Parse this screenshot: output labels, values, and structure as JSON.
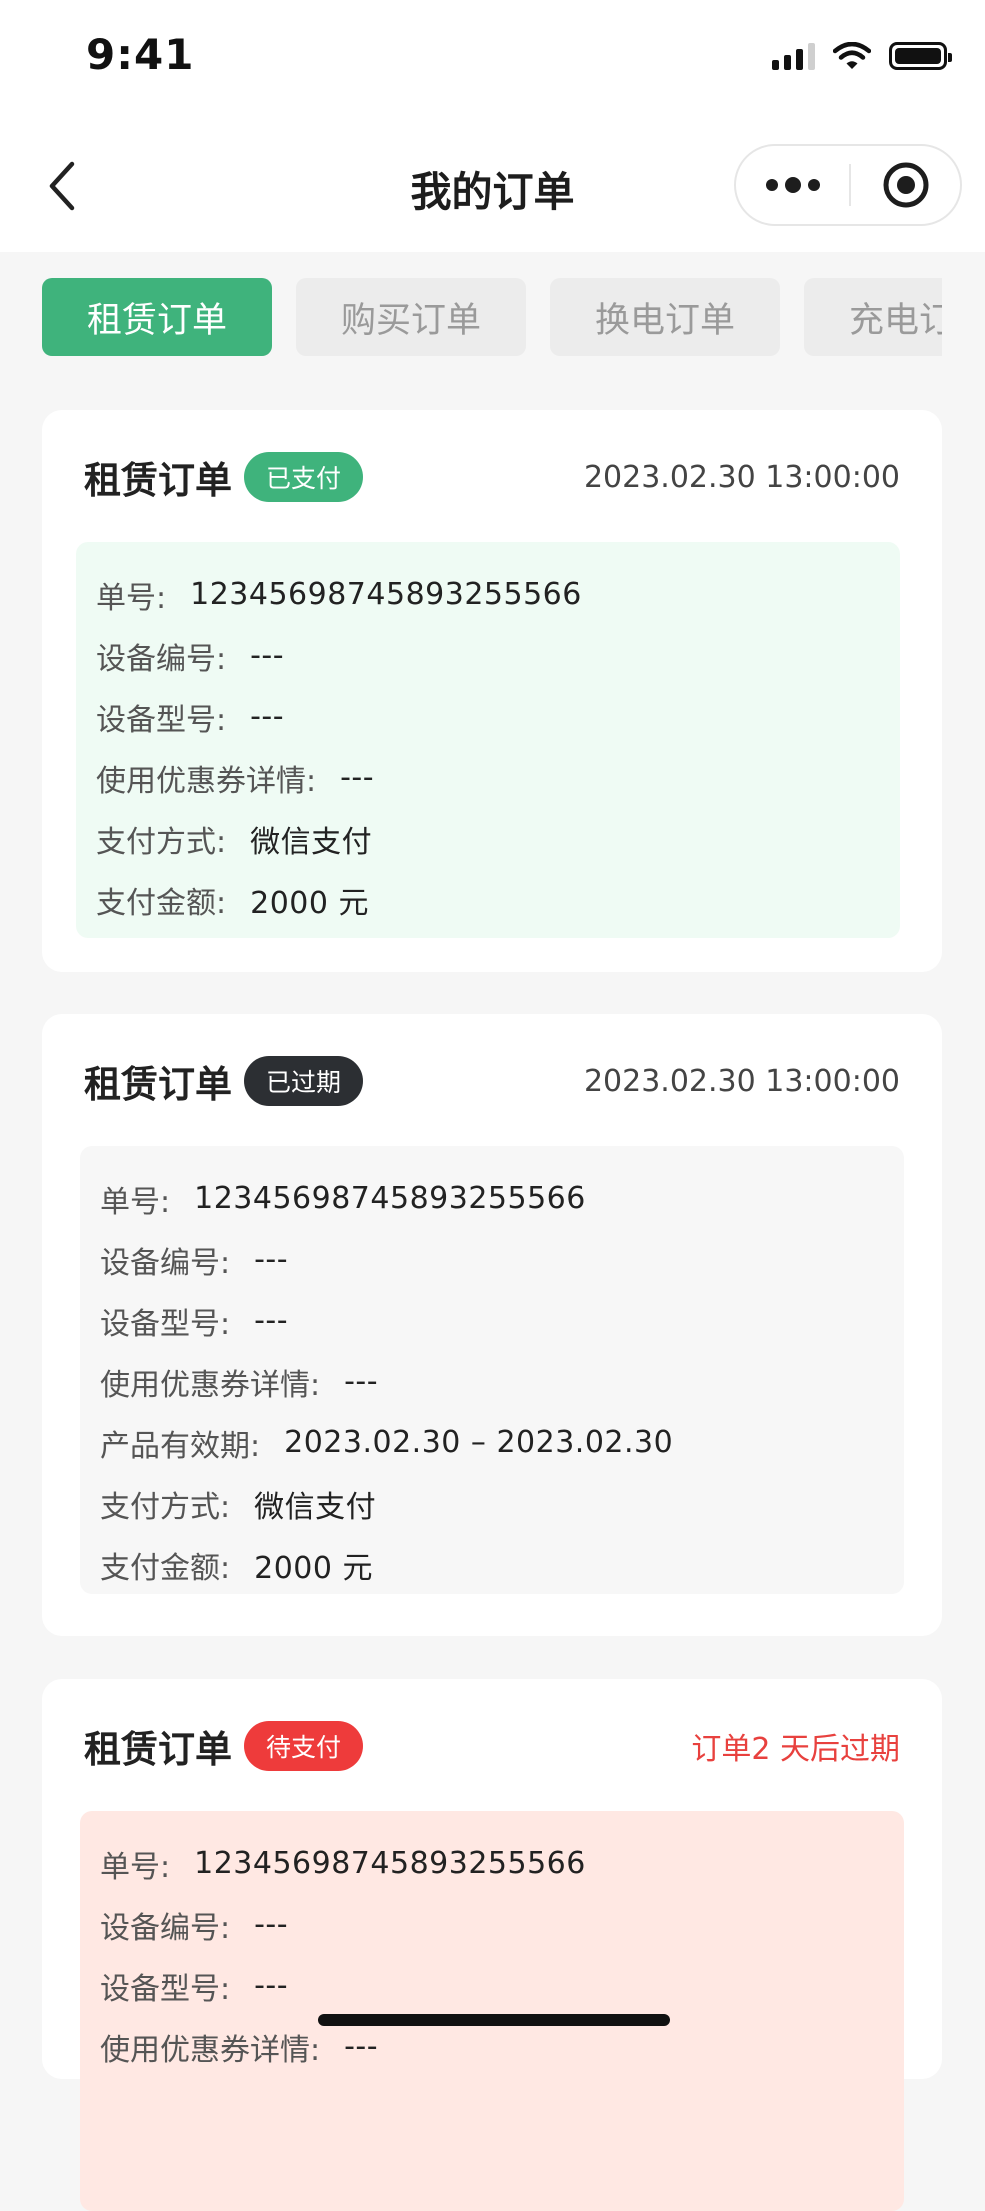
{
  "status_bar": {
    "time": "9:41"
  },
  "nav": {
    "title": "我的订单"
  },
  "tabs": [
    {
      "label": "租赁订单",
      "active": true
    },
    {
      "label": "购买订单",
      "active": false
    },
    {
      "label": "换电订单",
      "active": false
    },
    {
      "label": "充电订单",
      "active": false
    }
  ],
  "orders": [
    {
      "title": "租赁订单",
      "status": "已支付",
      "status_color": "#3fb37c",
      "time": "2023.02.30 13:00:00",
      "detail_bg": "#effbf4",
      "rows": [
        {
          "label": "单号:",
          "value": "12345698745893255566"
        },
        {
          "label": "设备编号:",
          "value": "---"
        },
        {
          "label": "设备型号:",
          "value": "---"
        },
        {
          "label": "使用优惠券详情:",
          "value": "---"
        },
        {
          "label": "支付方式:",
          "value": "微信支付"
        },
        {
          "label": "支付金额:",
          "value": "2000 元"
        }
      ]
    },
    {
      "title": "租赁订单",
      "status": "已过期",
      "status_color": "#2c2f33",
      "time": "2023.02.30 13:00:00",
      "detail_bg": "#f7f7f7",
      "rows": [
        {
          "label": "单号:",
          "value": "12345698745893255566"
        },
        {
          "label": "设备编号:",
          "value": "---"
        },
        {
          "label": "设备型号:",
          "value": "---"
        },
        {
          "label": "使用优惠券详情:",
          "value": "---"
        },
        {
          "label": "产品有效期:",
          "value": "2023.02.30 – 2023.02.30"
        },
        {
          "label": "支付方式:",
          "value": "微信支付"
        },
        {
          "label": "支付金额:",
          "value": "2000 元"
        }
      ]
    },
    {
      "title": "租赁订单",
      "status": "待支付",
      "status_color": "#ee3b3b",
      "time": "订单2 天后过期",
      "time_color": "#e8413e",
      "detail_bg": "#ffe8e3",
      "rows": [
        {
          "label": "单号:",
          "value": "12345698745893255566"
        },
        {
          "label": "设备编号:",
          "value": "---"
        },
        {
          "label": "设备型号:",
          "value": "---"
        },
        {
          "label": "使用优惠券详情:",
          "value": "---"
        }
      ]
    }
  ]
}
